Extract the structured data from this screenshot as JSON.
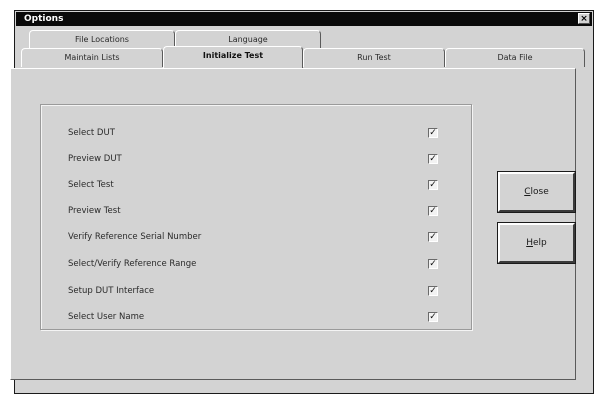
{
  "window": {
    "title": "Options",
    "close_glyph": "×"
  },
  "tabs_back": [
    {
      "label": "File Locations"
    },
    {
      "label": "Language"
    }
  ],
  "tabs_front": [
    {
      "label": "Maintain Lists"
    },
    {
      "label": "Initialize Test"
    },
    {
      "label": "Run Test"
    },
    {
      "label": "Data File"
    }
  ],
  "active_tab": "Initialize Test",
  "options": [
    {
      "label": "Select DUT",
      "checked": true
    },
    {
      "label": "Preview DUT",
      "checked": true
    },
    {
      "label": "Select Test",
      "checked": true
    },
    {
      "label": "Preview Test",
      "checked": true
    },
    {
      "label": "Verify Reference Serial Number",
      "checked": true
    },
    {
      "label": "Select/Verify Reference Range",
      "checked": true
    },
    {
      "label": "Setup DUT Interface",
      "checked": true
    },
    {
      "label": "Select User Name",
      "checked": true
    }
  ],
  "check_glyph": "✓",
  "buttons": {
    "close": {
      "mnemonic": "C",
      "rest": "lose"
    },
    "help": {
      "mnemonic": "H",
      "rest": "elp"
    }
  }
}
